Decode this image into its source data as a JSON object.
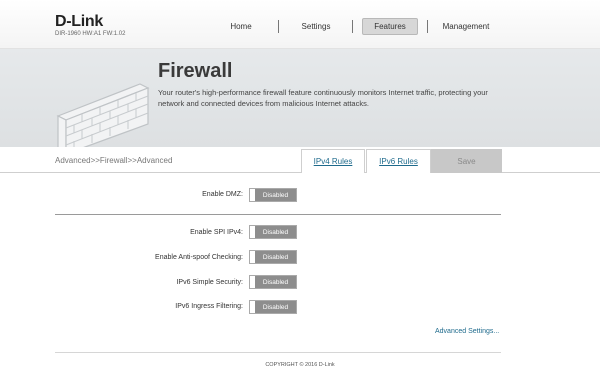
{
  "header": {
    "logo": "D-Link",
    "model": "DIR-1960 HW:A1 FW:1.02",
    "nav": [
      {
        "label": "Home"
      },
      {
        "label": "Settings"
      },
      {
        "label": "Features"
      },
      {
        "label": "Management"
      }
    ],
    "active_nav": "Features"
  },
  "banner": {
    "title": "Firewall",
    "description": "Your router's high-performance firewall feature continuously monitors Internet traffic, protecting your network and connected devices from malicious Internet attacks."
  },
  "tabbar": {
    "breadcrumb": "Advanced>>Firewall>>Advanced",
    "tabs": [
      {
        "label": "IPv4 Rules"
      },
      {
        "label": "IPv6 Rules"
      }
    ],
    "save_label": "Save"
  },
  "form": {
    "dmz": {
      "label": "Enable DMZ:",
      "state": "Disabled"
    },
    "settings": [
      {
        "label": "Enable SPI IPv4:",
        "state": "Disabled"
      },
      {
        "label": "Enable Anti-spoof Checking:",
        "state": "Disabled"
      },
      {
        "label": "IPv6 Simple Security:",
        "state": "Disabled"
      },
      {
        "label": "IPv6 Ingress Filtering:",
        "state": "Disabled"
      }
    ],
    "advanced_link": "Advanced Settings..."
  },
  "footer": {
    "copyright": "COPYRIGHT © 2016 D-Link"
  },
  "colors": {
    "link": "#1e6a8c",
    "toggle_off": "#8d8d8d",
    "save_disabled": "#c8c8c8"
  }
}
